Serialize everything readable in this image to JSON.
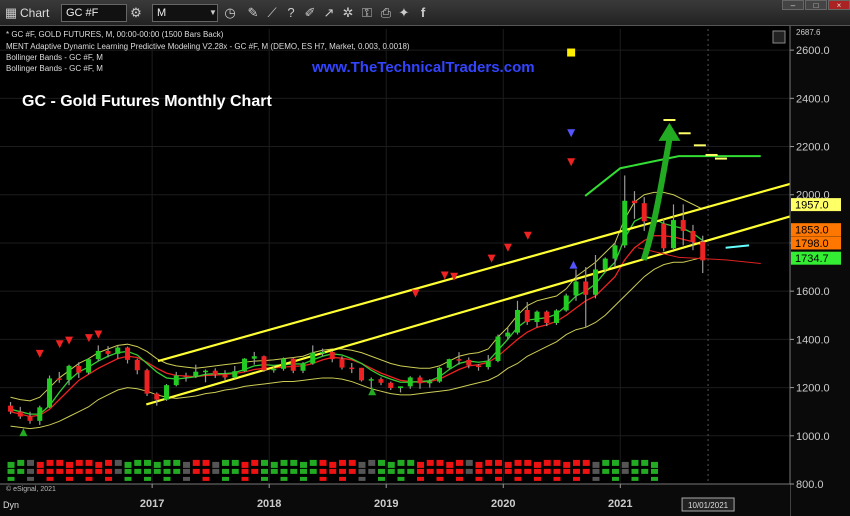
{
  "toolbar": {
    "app_label": "Chart",
    "symbol_value": "GC #F",
    "interval_value": "M",
    "icons": [
      "chart-icon",
      "dropdown-icon",
      "interval-dropdown-icon",
      "clock-icon",
      "draw-icon",
      "line-tool-icon",
      "question-icon",
      "pencil-icon",
      "arrow-icon",
      "settings-icon",
      "lock-icon",
      "printer-icon",
      "camera-icon",
      "twitter-icon",
      "facebook-icon"
    ]
  },
  "window": {
    "minimize": "–",
    "maximize": "□",
    "close": "×"
  },
  "legend": {
    "line1": "* GC #F, GOLD FUTURES, M, 00:00-00:00 (1500 Bars Back)",
    "line2": "MENT Adaptive Dynamic Learning Predictive Modeling V2.28x - GC #F, M (DEMO, ES H7, Market, 0.003, 0.0018)",
    "line3": "Bollinger Bands - GC #F, M",
    "line4": "Bollinger Bands - GC #F, M"
  },
  "watermark": "www.TheTechnicalTraders.com",
  "copyright": "© eSignal, 2021",
  "footer_left": "Dyn",
  "colors": {
    "background": "#000000",
    "up_candle": "#22cc22",
    "down_candle": "#ee2222",
    "neutral_candle": "#999999",
    "channel": "#ffff33",
    "forecast": "#33dd33",
    "watermark": "#3344ff",
    "price_tag_yellow": "#ffff66",
    "price_tag_orange": "#ff7700",
    "price_tag_green": "#33ee33"
  },
  "chart_data": {
    "type": "candlestick",
    "title": "GC - Gold Futures Monthly Chart",
    "xlabel": "",
    "ylabel": "",
    "ylim": [
      800,
      2687.6
    ],
    "y_ticks": [
      "2600.0",
      "2400.0",
      "2200.0",
      "2000.0",
      "1800.0",
      "1600.0",
      "1400.0",
      "1200.0",
      "1000.0",
      "800.0"
    ],
    "y_tick_values": [
      2600,
      2400,
      2200,
      2000,
      1800,
      1600,
      1400,
      1200,
      1000,
      800
    ],
    "x_ticks": [
      "2017",
      "2018",
      "2019",
      "2020",
      "2021"
    ],
    "x_tick_values": [
      2017,
      2018,
      2019,
      2020,
      2021
    ],
    "x_range": [
      2015.7,
      2022.45
    ],
    "top_price_label": "2687.6",
    "date_label": "10/01/2021",
    "date_label_value": 2021.75,
    "price_tags": [
      {
        "label": "1957.0",
        "value": 1957.0,
        "color": "yellow"
      },
      {
        "label": "1853.0",
        "value": 1853.0,
        "color": "orange"
      },
      {
        "label": "1798.0",
        "value": 1798.0,
        "color": "orange"
      },
      {
        "label": "1734.7",
        "value": 1734.7,
        "color": "green"
      }
    ],
    "candles_start": 2015.79,
    "candle_step": 0.0833,
    "candles": [
      [
        1125,
        1140,
        1090,
        1100
      ],
      [
        1100,
        1120,
        1070,
        1080
      ],
      [
        1080,
        1100,
        1050,
        1062
      ],
      [
        1062,
        1125,
        1045,
        1118
      ],
      [
        1118,
        1250,
        1115,
        1238
      ],
      [
        1238,
        1265,
        1220,
        1232
      ],
      [
        1232,
        1295,
        1210,
        1290
      ],
      [
        1290,
        1305,
        1240,
        1262
      ],
      [
        1262,
        1320,
        1255,
        1318
      ],
      [
        1318,
        1375,
        1310,
        1352
      ],
      [
        1352,
        1372,
        1325,
        1340
      ],
      [
        1340,
        1375,
        1320,
        1366
      ],
      [
        1366,
        1370,
        1300,
        1315
      ],
      [
        1315,
        1320,
        1255,
        1272
      ],
      [
        1272,
        1278,
        1165,
        1175
      ],
      [
        1175,
        1180,
        1125,
        1150
      ],
      [
        1150,
        1215,
        1145,
        1210
      ],
      [
        1210,
        1265,
        1205,
        1250
      ],
      [
        1250,
        1262,
        1225,
        1248
      ],
      [
        1248,
        1295,
        1240,
        1266
      ],
      [
        1266,
        1275,
        1222,
        1270
      ],
      [
        1270,
        1280,
        1240,
        1255
      ],
      [
        1255,
        1272,
        1232,
        1242
      ],
      [
        1242,
        1290,
        1238,
        1268
      ],
      [
        1268,
        1322,
        1265,
        1320
      ],
      [
        1320,
        1348,
        1295,
        1330
      ],
      [
        1330,
        1333,
        1265,
        1272
      ],
      [
        1272,
        1290,
        1262,
        1278
      ],
      [
        1278,
        1325,
        1270,
        1320
      ],
      [
        1320,
        1325,
        1260,
        1270
      ],
      [
        1270,
        1306,
        1260,
        1300
      ],
      [
        1300,
        1375,
        1295,
        1345
      ],
      [
        1345,
        1362,
        1330,
        1348
      ],
      [
        1348,
        1352,
        1305,
        1318
      ],
      [
        1318,
        1330,
        1275,
        1283
      ],
      [
        1283,
        1302,
        1260,
        1282
      ],
      [
        1282,
        1282,
        1225,
        1230
      ],
      [
        1230,
        1242,
        1197,
        1235
      ],
      [
        1235,
        1242,
        1210,
        1220
      ],
      [
        1220,
        1225,
        1190,
        1198
      ],
      [
        1198,
        1205,
        1180,
        1205
      ],
      [
        1205,
        1247,
        1195,
        1242
      ],
      [
        1242,
        1250,
        1195,
        1218
      ],
      [
        1218,
        1235,
        1200,
        1225
      ],
      [
        1225,
        1285,
        1220,
        1282
      ],
      [
        1282,
        1320,
        1278,
        1318
      ],
      [
        1318,
        1347,
        1295,
        1315
      ],
      [
        1315,
        1325,
        1280,
        1292
      ],
      [
        1292,
        1298,
        1270,
        1285
      ],
      [
        1285,
        1335,
        1275,
        1310
      ],
      [
        1310,
        1420,
        1305,
        1412
      ],
      [
        1412,
        1450,
        1400,
        1428
      ],
      [
        1428,
        1560,
        1420,
        1522
      ],
      [
        1522,
        1555,
        1460,
        1472
      ],
      [
        1472,
        1520,
        1450,
        1515
      ],
      [
        1515,
        1520,
        1455,
        1468
      ],
      [
        1468,
        1525,
        1460,
        1520
      ],
      [
        1520,
        1590,
        1515,
        1582
      ],
      [
        1582,
        1690,
        1560,
        1640
      ],
      [
        1640,
        1700,
        1450,
        1585
      ],
      [
        1585,
        1750,
        1570,
        1690
      ],
      [
        1690,
        1740,
        1680,
        1735
      ],
      [
        1735,
        1800,
        1700,
        1790
      ],
      [
        1790,
        2080,
        1780,
        1975
      ],
      [
        1975,
        2015,
        1900,
        1965
      ],
      [
        1965,
        1990,
        1850,
        1890
      ],
      [
        1890,
        1935,
        1860,
        1880
      ],
      [
        1880,
        1900,
        1765,
        1778
      ],
      [
        1778,
        1960,
        1775,
        1895
      ],
      [
        1895,
        1960,
        1790,
        1850
      ],
      [
        1850,
        1875,
        1770,
        1805
      ],
      [
        1805,
        1830,
        1675,
        1728
      ]
    ],
    "series": [
      {
        "key": "bb_upper",
        "color": "#cccc55",
        "values": [
          1160,
          1150,
          1145,
          1160,
          1200,
          1240,
          1270,
          1300,
          1320,
          1345,
          1360,
          1375,
          1380,
          1370,
          1350,
          1320,
          1300,
          1290,
          1285,
          1280,
          1285,
          1290,
          1295,
          1300,
          1305,
          1310,
          1312,
          1315,
          1320,
          1325,
          1330,
          1345,
          1355,
          1360,
          1360,
          1355,
          1345,
          1330,
          1315,
          1300,
          1290,
          1285,
          1280,
          1280,
          1290,
          1310,
          1330,
          1340,
          1345,
          1360,
          1410,
          1450,
          1500,
          1540,
          1560,
          1570,
          1580,
          1610,
          1660,
          1690,
          1720,
          1760,
          1800,
          1900,
          1970,
          2000,
          2010,
          2010,
          2000,
          1980,
          1960,
          1940
        ]
      },
      {
        "key": "bb_lower",
        "color": "#cccc55",
        "values": [
          1040,
          1035,
          1030,
          1035,
          1045,
          1060,
          1080,
          1100,
          1120,
          1150,
          1170,
          1190,
          1200,
          1195,
          1185,
          1170,
          1160,
          1155,
          1160,
          1165,
          1175,
          1180,
          1190,
          1195,
          1205,
          1210,
          1215,
          1220,
          1225,
          1225,
          1230,
          1235,
          1240,
          1240,
          1235,
          1225,
          1210,
          1195,
          1185,
          1175,
          1170,
          1170,
          1175,
          1180,
          1185,
          1190,
          1200,
          1210,
          1220,
          1230,
          1250,
          1280,
          1300,
          1330,
          1350,
          1370,
          1390,
          1420,
          1440,
          1450,
          1470,
          1500,
          1540,
          1580,
          1620,
          1660,
          1690,
          1710,
          1720,
          1720,
          1730,
          1740
        ]
      },
      {
        "key": "ma_fast",
        "color": "#ee2222",
        "values": [
          1100,
          1090,
          1080,
          1085,
          1110,
          1150,
          1190,
          1230,
          1255,
          1280,
          1300,
          1320,
          1330,
          1325,
          1305,
          1280,
          1260,
          1250,
          1248,
          1245,
          1250,
          1252,
          1255,
          1258,
          1265,
          1275,
          1280,
          1282,
          1285,
          1288,
          1290,
          1300,
          1315,
          1325,
          1322,
          1315,
          1300,
          1280,
          1260,
          1245,
          1230,
          1225,
          1222,
          1225,
          1235,
          1255,
          1275,
          1290,
          1295,
          1305,
          1330,
          1365,
          1400,
          1430,
          1450,
          1460,
          1475,
          1500,
          1530,
          1560,
          1580,
          1620,
          1660,
          1730,
          1780,
          1810,
          1830,
          1830,
          1825,
          1815,
          1805,
          1790
        ]
      },
      {
        "key": "ma_green",
        "color": "#33cc33",
        "values": [
          1110,
          1100,
          1090,
          1090,
          1125,
          1180,
          1230,
          1265,
          1285,
          1310,
          1330,
          1345,
          1350,
          1335,
          1300,
          1265,
          1240,
          1235,
          1240,
          1245,
          1255,
          1258,
          1258,
          1262,
          1275,
          1290,
          1295,
          1292,
          1295,
          1298,
          1298,
          1315,
          1330,
          1340,
          1335,
          1320,
          1300,
          1272,
          1250,
          1235,
          1222,
          1222,
          1225,
          1228,
          1245,
          1275,
          1300,
          1310,
          1305,
          1310,
          1355,
          1400,
          1450,
          1480,
          1485,
          1490,
          1505,
          1540,
          1580,
          1600,
          1630,
          1680,
          1720,
          1820,
          1890,
          1910,
          1900,
          1880,
          1870,
          1860,
          1840,
          1810
        ]
      }
    ],
    "channel_upper": {
      "x": [
        2017.05,
        2022.45
      ],
      "y": [
        1310,
        2045
      ]
    },
    "channel_lower": {
      "x": [
        2016.95,
        2022.45
      ],
      "y": [
        1130,
        1910
      ]
    },
    "forecast_line": {
      "x": [
        2020.7,
        2021.0,
        2021.5,
        2022.2
      ],
      "y": [
        1995,
        2110,
        2160,
        2160
      ]
    },
    "forecast_red": {
      "x": [
        2021.15,
        2021.5,
        2021.9,
        2022.2
      ],
      "y": [
        1780,
        1740,
        1730,
        1715
      ]
    },
    "forecast_cyan": {
      "x": [
        2021.9,
        2022.1
      ],
      "y": [
        1780,
        1790
      ]
    },
    "forecast_arrow": {
      "x": [
        2021.2,
        2021.42
      ],
      "y": [
        1730,
        2290
      ]
    },
    "forecast_dashes": [
      {
        "x": 2021.42,
        "y": 2310,
        "color": "#ffff66"
      },
      {
        "x": 2021.55,
        "y": 2255,
        "color": "#ffff66"
      },
      {
        "x": 2021.68,
        "y": 2205,
        "color": "#ffff66"
      },
      {
        "x": 2021.78,
        "y": 2165,
        "color": "#ffff66"
      },
      {
        "x": 2021.86,
        "y": 2150,
        "color": "#ffff66"
      }
    ],
    "signals_down_red": [
      {
        "x": 2016.04,
        "y": 1340
      },
      {
        "x": 2016.21,
        "y": 1380
      },
      {
        "x": 2016.29,
        "y": 1395
      },
      {
        "x": 2016.46,
        "y": 1405
      },
      {
        "x": 2016.54,
        "y": 1420
      },
      {
        "x": 2019.25,
        "y": 1590
      },
      {
        "x": 2019.5,
        "y": 1665
      },
      {
        "x": 2019.58,
        "y": 1660
      },
      {
        "x": 2019.9,
        "y": 1735
      },
      {
        "x": 2020.04,
        "y": 1780
      },
      {
        "x": 2020.21,
        "y": 1830
      },
      {
        "x": 2020.58,
        "y": 2135
      }
    ],
    "signals_up_green": [
      {
        "x": 2015.9,
        "y": 1015
      },
      {
        "x": 2018.88,
        "y": 1185
      }
    ],
    "signals_down_blue": [
      {
        "x": 2020.58,
        "y": 2255
      }
    ],
    "signals_up_blue": [
      {
        "x": 2020.6,
        "y": 1710
      }
    ],
    "top_marker": {
      "x": 2020.58,
      "y": 2590,
      "color": "#ffee00"
    },
    "bottom_blocks": [
      1,
      1,
      0,
      2,
      2,
      2,
      2,
      2,
      2,
      2,
      2,
      0,
      1,
      1,
      1,
      1,
      1,
      1,
      0,
      2,
      2,
      0,
      1,
      1,
      2,
      2,
      1,
      1,
      1,
      1,
      1,
      1,
      2,
      2,
      2,
      2,
      0,
      0,
      1,
      1,
      1,
      1,
      2,
      2,
      2,
      2,
      2,
      0,
      2,
      2,
      2,
      2,
      2,
      2,
      2,
      2,
      2,
      2,
      2,
      2,
      0,
      1,
      1,
      0,
      1,
      1,
      1
    ]
  }
}
